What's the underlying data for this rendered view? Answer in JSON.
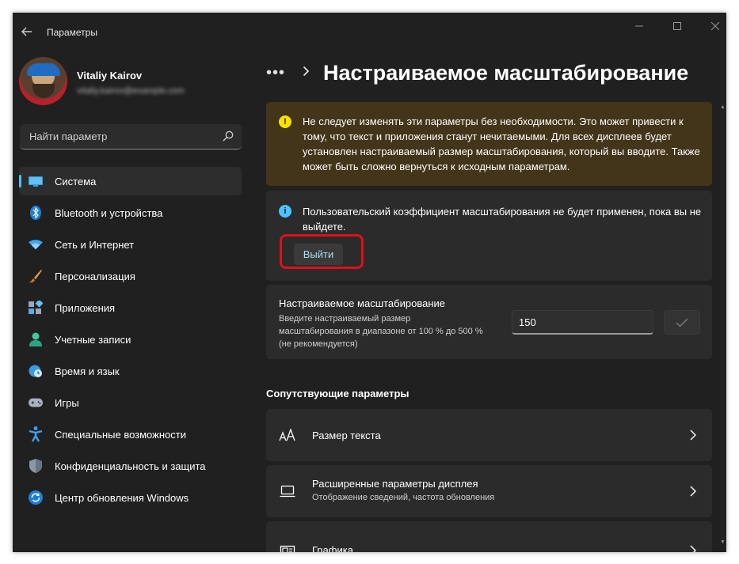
{
  "window": {
    "title": "Параметры"
  },
  "profile": {
    "name": "Vitaliy Kairov",
    "email": "vitaliy.kairov@example.com"
  },
  "search": {
    "placeholder": "Найти параметр"
  },
  "nav": {
    "items": [
      {
        "label": "Система",
        "icon": "monitor-icon",
        "active": true
      },
      {
        "label": "Bluetooth и устройства",
        "icon": "bluetooth-icon"
      },
      {
        "label": "Сеть и Интернет",
        "icon": "wifi-icon"
      },
      {
        "label": "Персонализация",
        "icon": "brush-icon"
      },
      {
        "label": "Приложения",
        "icon": "apps-icon"
      },
      {
        "label": "Учетные записи",
        "icon": "person-icon"
      },
      {
        "label": "Время и язык",
        "icon": "globe-clock-icon"
      },
      {
        "label": "Игры",
        "icon": "gamepad-icon"
      },
      {
        "label": "Специальные возможности",
        "icon": "accessibility-icon"
      },
      {
        "label": "Конфиденциальность и защита",
        "icon": "shield-icon"
      },
      {
        "label": "Центр обновления Windows",
        "icon": "update-icon"
      }
    ]
  },
  "header": {
    "more": "•••",
    "title": "Настраиваемое масштабирование"
  },
  "warning": {
    "text": "Не следует изменять эти параметры без необходимости. Это может привести к тому, что текст и приложения станут нечитаемыми. Для всех дисплеев будет установлен настраиваемый размер масштабирования, который вы вводите. Также может быть сложно вернуться к исходным параметрам."
  },
  "info": {
    "text": "Пользовательский коэффициент масштабирования не будет применен, пока вы не выйдете.",
    "button": "Выйти"
  },
  "custom_scale": {
    "title": "Настраиваемое масштабирование",
    "description": "Введите настраиваемый размер масштабирования в диапазоне от 100 % до 500 % (не рекомендуется)",
    "value": "150"
  },
  "related": {
    "title": "Сопутствующие параметры",
    "items": [
      {
        "title": "Размер текста",
        "subtitle": "",
        "icon": "text-size-icon"
      },
      {
        "title": "Расширенные параметры дисплея",
        "subtitle": "Отображение сведений, частота обновления",
        "icon": "display-icon"
      },
      {
        "title": "Графика",
        "subtitle": "",
        "icon": "graphics-icon"
      }
    ]
  },
  "colors": {
    "accent": "#4cc2ff",
    "warning": "#fce100",
    "highlight": "#e0101a",
    "background": "#202020"
  }
}
